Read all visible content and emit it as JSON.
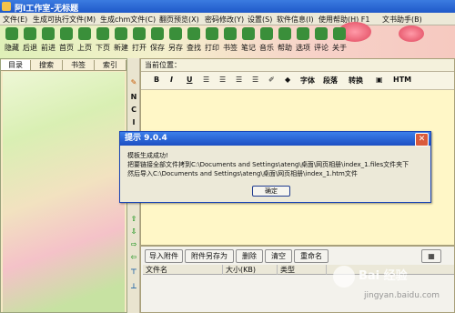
{
  "window": {
    "title": "阿I工作室-无标题"
  },
  "menu": [
    "文件(E)",
    "生成可执行文件(M)",
    "生成chm文件(C)",
    "翻页预览(X)",
    "密码修改(Y)",
    "设置(S)",
    "软件信息(I)",
    "使用帮助(H) F1",
    "文书助手(B)"
  ],
  "toolbar": [
    {
      "label": "隐藏",
      "icon": "hide-icon"
    },
    {
      "label": "后退",
      "icon": "back-icon"
    },
    {
      "label": "前进",
      "icon": "forward-icon"
    },
    {
      "label": "首页",
      "icon": "home-icon"
    },
    {
      "label": "上页",
      "icon": "prev-page-icon"
    },
    {
      "label": "下页",
      "icon": "next-page-icon"
    },
    {
      "label": "新建",
      "icon": "new-icon"
    },
    {
      "label": "打开",
      "icon": "open-icon"
    },
    {
      "label": "保存",
      "icon": "save-icon"
    },
    {
      "label": "另存",
      "icon": "save-as-icon"
    },
    {
      "label": "查找",
      "icon": "find-icon"
    },
    {
      "label": "打印",
      "icon": "print-icon"
    },
    {
      "label": "书签",
      "icon": "bookmark-icon"
    },
    {
      "label": "笔记",
      "icon": "note-icon"
    },
    {
      "label": "音乐",
      "icon": "music-icon"
    },
    {
      "label": "帮助",
      "icon": "help-icon"
    },
    {
      "label": "选项",
      "icon": "options-icon"
    },
    {
      "label": "评论",
      "icon": "comment-icon"
    },
    {
      "label": "关于",
      "icon": "about-icon"
    }
  ],
  "left_tabs": [
    "目录",
    "搜索",
    "书签",
    "索引"
  ],
  "editor": {
    "position_label": "当前位置：",
    "format_buttons": [
      "B",
      "I",
      "U",
      "字体",
      "段落",
      "转换",
      "HTM"
    ]
  },
  "vstrip": [
    "N",
    "C",
    "I",
    "P"
  ],
  "dialog": {
    "title": "提示 9.0.4",
    "line1": "模板生成成功!",
    "line2": "把要链接全部文件拷到C:\\Documents and Settings\\ateng\\桌面\\网页相册\\index_1.files文件夹下",
    "line3": "然后导入C:\\Documents and Settings\\ateng\\桌面\\网页相册\\index_1.htm文件",
    "ok": "确定",
    "close_icon": "close-icon"
  },
  "attachments": {
    "buttons": [
      "导入附件",
      "附件另存为",
      "删除",
      "清空",
      "重命名"
    ],
    "columns": [
      "文件名",
      "大小(KB)",
      "类型"
    ]
  },
  "watermark": {
    "brand": "Bai 经验",
    "url": "jingyan.baidu.com"
  }
}
